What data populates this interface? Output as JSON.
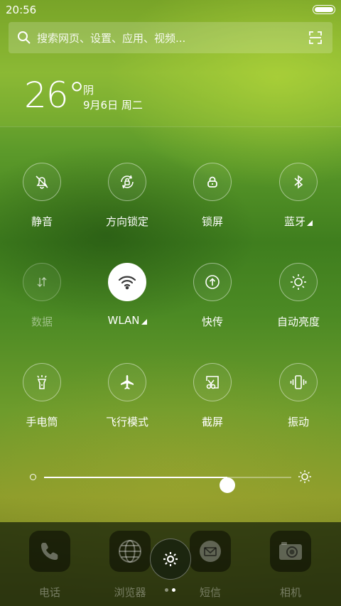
{
  "status_bar": {
    "time": "20:56"
  },
  "search": {
    "placeholder": "搜索网页、设置、应用、视频..."
  },
  "weather": {
    "temperature": "26°",
    "condition": "阴",
    "date": "9月6日 周二"
  },
  "toggles": [
    {
      "label": "静音",
      "icon": "silent-bell-icon",
      "active": false,
      "dim": false
    },
    {
      "label": "方向锁定",
      "icon": "rotation-lock-icon",
      "active": false,
      "dim": false
    },
    {
      "label": "锁屏",
      "icon": "lock-icon",
      "active": false,
      "dim": false
    },
    {
      "label": "蓝牙",
      "icon": "bluetooth-icon",
      "active": false,
      "dim": false,
      "expandable": true
    },
    {
      "label": "数据",
      "icon": "data-arrows-icon",
      "active": false,
      "dim": true
    },
    {
      "label": "WLAN",
      "icon": "wifi-icon",
      "active": true,
      "dim": false,
      "expandable": true
    },
    {
      "label": "快传",
      "icon": "quick-transfer-icon",
      "active": false,
      "dim": false
    },
    {
      "label": "自动亮度",
      "icon": "auto-brightness-icon",
      "active": false,
      "dim": false
    },
    {
      "label": "手电筒",
      "icon": "flashlight-icon",
      "active": false,
      "dim": false
    },
    {
      "label": "飞行模式",
      "icon": "airplane-icon",
      "active": false,
      "dim": false
    },
    {
      "label": "截屏",
      "icon": "screenshot-icon",
      "active": false,
      "dim": false
    },
    {
      "label": "振动",
      "icon": "vibrate-icon",
      "active": false,
      "dim": false
    }
  ],
  "brightness": {
    "level_percent": 74
  },
  "dock": {
    "apps": [
      {
        "label": "电话",
        "icon": "phone-icon"
      },
      {
        "label": "浏览器",
        "icon": "browser-globe-icon"
      },
      {
        "label": "短信",
        "icon": "message-icon"
      },
      {
        "label": "相机",
        "icon": "camera-icon"
      }
    ]
  },
  "pager": {
    "count": 2,
    "active_index": 1
  },
  "colors": {
    "accent_green": "#3f7e1e",
    "wifi_icon_active": "#3a3a3a"
  }
}
